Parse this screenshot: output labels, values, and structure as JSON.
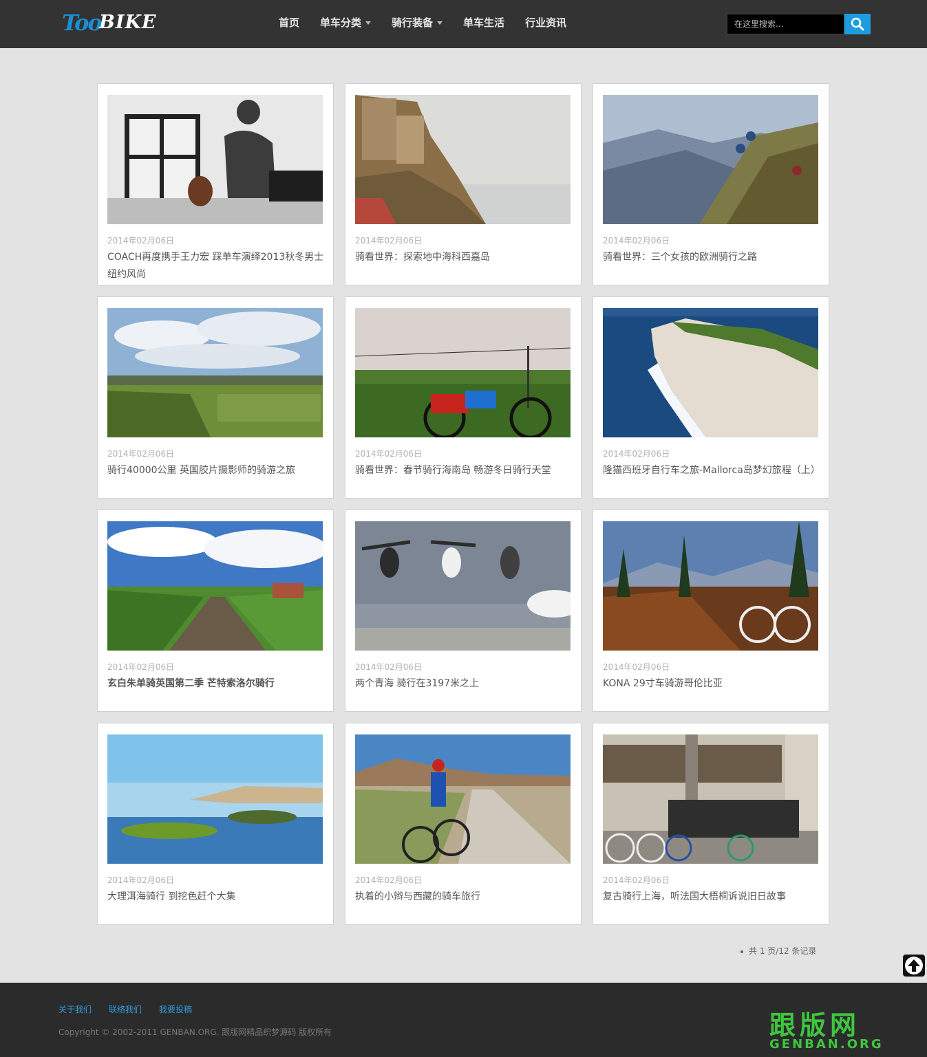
{
  "brand": {
    "logo_left": "Too",
    "logo_right": "BIKE"
  },
  "nav": [
    {
      "label": "首页",
      "has_dropdown": false
    },
    {
      "label": "单车分类",
      "has_dropdown": true
    },
    {
      "label": "骑行装备",
      "has_dropdown": true
    },
    {
      "label": "单车生活",
      "has_dropdown": false
    },
    {
      "label": "行业资讯",
      "has_dropdown": false
    }
  ],
  "search": {
    "placeholder": "在这里搜索...",
    "value": ""
  },
  "articles": [
    {
      "date": "2014年02月06日",
      "title": "COACH再度携手王力宏 踩单车演绎2013秋冬男士纽约风尚",
      "image": "man-studio-photo"
    },
    {
      "date": "2014年02月06日",
      "title": "骑看世界：探索地中海科西嘉岛",
      "image": "cliff-village-photo"
    },
    {
      "date": "2014年02月06日",
      "title": "骑看世界：三个女孩的欧洲骑行之路",
      "image": "mountain-riders-photo"
    },
    {
      "date": "2014年02月06日",
      "title": "骑行40000公里 英国胶片摄影师的骑游之旅",
      "image": "pasture-photo"
    },
    {
      "date": "2014年02月06日",
      "title": "骑看世界：春节骑行海南岛 畅游冬日骑行天堂",
      "image": "loaded-bike-photo"
    },
    {
      "date": "2014年02月06日",
      "title": "隆猫西班牙自行车之旅-Mallorca岛梦幻旅程（上）",
      "image": "sea-cliff-photo"
    },
    {
      "date": "2014年02月06日",
      "title": "玄白朱单骑英国第二季 芒特索洛尔骑行",
      "image": "railway-photo"
    },
    {
      "date": "2014年02月06日",
      "title": "两个青海 骑行在3197米之上",
      "image": "jumping-men-photo"
    },
    {
      "date": "2014年02月06日",
      "title": "KONA 29寸车骑游哥伦比亚",
      "image": "forest-rider-photo"
    },
    {
      "date": "2014年02月06日",
      "title": "大理洱海骑行 到挖色赶个大集",
      "image": "lake-photo"
    },
    {
      "date": "2014年02月06日",
      "title": "执着的小辫与西藏的骑车旅行",
      "image": "desert-road-photo"
    },
    {
      "date": "2014年02月06日",
      "title": "复古骑行上海，听法国大梧桐诉说旧日故事",
      "image": "group-bikes-photo"
    }
  ],
  "pager": {
    "text": "共 1 页/12 条记录"
  },
  "footer": {
    "links": [
      "关于我们",
      "联络我们",
      "我要投稿"
    ],
    "copyright": "Copyright © 2002-2011 GENBAN.ORG. 跟版网精品织梦源码 版权所有",
    "watermark_cn": "跟版网",
    "watermark_en": "GENBAN.ORG"
  },
  "colors": {
    "header": "#333333",
    "accent": "#1e9ce0",
    "page_bg": "#e3e3e3",
    "footer": "#2b2b2b",
    "watermark": "#3ec63e"
  }
}
